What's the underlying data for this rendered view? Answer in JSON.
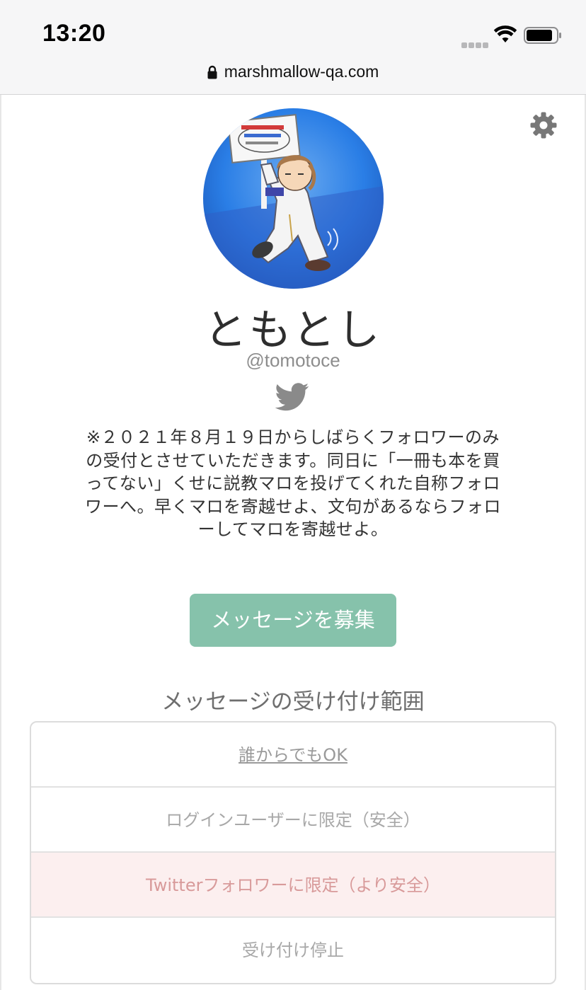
{
  "status_bar": {
    "time": "13:20",
    "url": "marshmallow-qa.com"
  },
  "profile": {
    "name": "ともとし",
    "handle": "@tomotoce",
    "bio": "※２０２１年８月１９日からしばらくフォロワーのみの受付とさせていただきます。同日に「一冊も本を買ってない」くせに説教マロを投げてくれた自称フォロワーへ。早くマロを寄越せよ、文句があるならフォローしてマロを寄越せよ。"
  },
  "cta": {
    "label": "メッセージを募集"
  },
  "range": {
    "title": "メッセージの受け付け範囲",
    "options": [
      {
        "label": "誰からでもOK"
      },
      {
        "label": "ログインユーザーに限定（安全）"
      },
      {
        "label": "Twitterフォロワーに限定（より安全）"
      },
      {
        "label": "受け付け停止"
      }
    ]
  },
  "icons": {
    "lock": "lock-icon",
    "settings": "gear-icon",
    "twitter": "twitter-bird-icon",
    "wifi": "wifi-icon",
    "battery": "battery-icon",
    "signal": "cellular-signal-icon"
  },
  "colors": {
    "accent_button": "#86c2ab",
    "selected_option_bg": "#fcefef",
    "selected_option_text": "#d89a9a"
  }
}
